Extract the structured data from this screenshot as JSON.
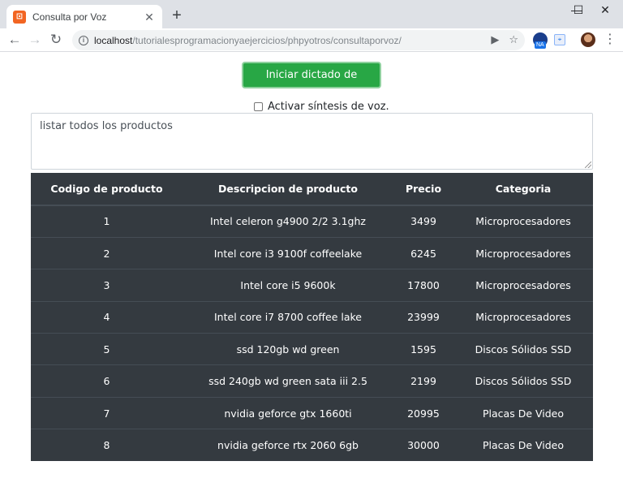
{
  "browser": {
    "tab_title": "Consulta por Voz",
    "tab_close": "✕",
    "new_tab": "+",
    "favicon_glyph": "⊡",
    "url_host": "localhost",
    "url_path": "/tutorialesprogramacionyaejercicios/phpyotros/consultaporvoz/",
    "ext_badge": "NA",
    "ext2_glyph": "⌖",
    "window_controls": {
      "minimize": "—",
      "maximize": "☐",
      "close": "✕"
    },
    "nav": {
      "back": "←",
      "forward": "→",
      "reload": "↻"
    },
    "omni_icons": {
      "camera": "▶",
      "star": "☆"
    },
    "menu": "⋮",
    "info": "i"
  },
  "page": {
    "dictation_button": "Iniciar dictado de consulta",
    "voice_synthesis_label": "Activar síntesis de voz.",
    "query_text": "listar todos los productos"
  },
  "table": {
    "headers": [
      "Codigo de producto",
      "Descripcion de producto",
      "Precio",
      "Categoria"
    ],
    "rows": [
      [
        "1",
        "Intel celeron g4900 2/2 3.1ghz",
        "3499",
        "Microprocesadores"
      ],
      [
        "2",
        "Intel core i3 9100f coffeelake",
        "6245",
        "Microprocesadores"
      ],
      [
        "3",
        "Intel core i5 9600k",
        "17800",
        "Microprocesadores"
      ],
      [
        "4",
        "Intel core i7 8700 coffee lake",
        "23999",
        "Microprocesadores"
      ],
      [
        "5",
        "ssd 120gb wd green",
        "1595",
        "Discos Sólidos SSD"
      ],
      [
        "6",
        "ssd 240gb wd green sata iii 2.5",
        "2199",
        "Discos Sólidos SSD"
      ],
      [
        "7",
        "nvidia geforce gtx 1660ti",
        "20995",
        "Placas De Video"
      ],
      [
        "8",
        "nvidia geforce rtx 2060 6gb",
        "30000",
        "Placas De Video"
      ]
    ]
  },
  "colors": {
    "button_green": "#28a745",
    "table_dark": "#343a40",
    "tab_bar": "#dee1e6"
  }
}
